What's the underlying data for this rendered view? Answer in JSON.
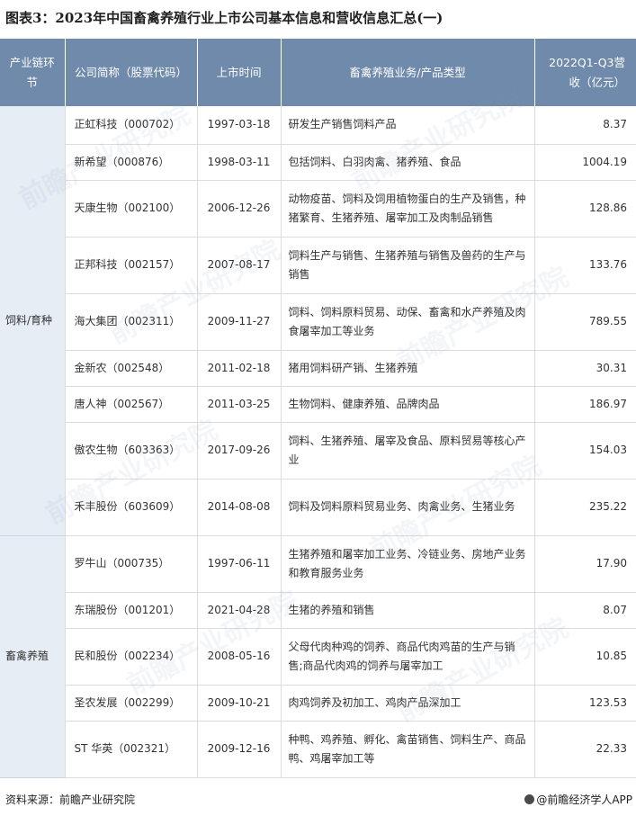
{
  "title": "图表3：2023年中国畜禽养殖行业上市公司基本信息和营收信息汇总(一)",
  "table": {
    "headers": [
      "产业链环节",
      "公司简称（股票代码）",
      "上市时间",
      "畜禽养殖业务/产品类型",
      "2022Q1-Q3营收（亿元）"
    ],
    "segments": [
      {
        "name": "饲料/育种",
        "rows": [
          {
            "company": "正虹科技（000702）",
            "date": "1997-03-18",
            "business": "研发生产销售饲料产品",
            "revenue": "8.37"
          },
          {
            "company": "新希望（000876）",
            "date": "1998-03-11",
            "business": "包括饲料、白羽肉禽、猪养殖、食品",
            "revenue": "1004.19"
          },
          {
            "company": "天康生物（002100）",
            "date": "2006-12-26",
            "business": "动物疫苗、饲料及饲用植物蛋白的生产及销售，种猪繁育、生猪养殖、屠宰加工及肉制品销售",
            "revenue": "128.86"
          },
          {
            "company": "正邦科技（002157）",
            "date": "2007-08-17",
            "business": "饲料生产与销售、生猪养殖与销售及兽药的生产与销售",
            "revenue": "133.76"
          },
          {
            "company": "海大集团（002311）",
            "date": "2009-11-27",
            "business": "饲料、饲料原料贸易、动保、畜禽和水产养殖及肉食屠宰加工等业务",
            "revenue": "789.55"
          },
          {
            "company": "金新农（002548）",
            "date": "2011-02-18",
            "business": "猪用饲料研产销、生猪养殖",
            "revenue": "30.31"
          },
          {
            "company": "唐人神（002567）",
            "date": "2011-03-25",
            "business": "生物饲料、健康养殖、品牌肉品",
            "revenue": "186.97"
          },
          {
            "company": "傲农生物（603363）",
            "date": "2017-09-26",
            "business": "饲料、生猪养殖、屠宰及食品、原料贸易等核心产业",
            "revenue": "154.03"
          },
          {
            "company": "禾丰股份（603609）",
            "date": "2014-08-08",
            "business": "饲料及饲料原料贸易业务、肉禽业务、生猪业务",
            "revenue": "235.22"
          }
        ]
      },
      {
        "name": "畜禽养殖",
        "rows": [
          {
            "company": "罗牛山（000735）",
            "date": "1997-06-11",
            "business": "生猪养殖和屠宰加工业务、冷链业务、房地产业务和教育服务业务",
            "revenue": "17.90"
          },
          {
            "company": "东瑞股份（001201）",
            "date": "2021-04-28",
            "business": "生猪的养殖和销售",
            "revenue": "8.07"
          },
          {
            "company": "民和股份（002234）",
            "date": "2008-05-16",
            "business": "父母代肉种鸡的饲养、商品代肉鸡苗的生产与销售;商品代肉鸡的饲养与屠宰加工",
            "revenue": "10.85"
          },
          {
            "company": "圣农发展（002299）",
            "date": "2009-10-21",
            "business": "肉鸡饲养及初加工、鸡肉产品深加工",
            "revenue": "123.53"
          },
          {
            "company": "ST 华英（002321）",
            "date": "2009-12-16",
            "business": "种鸭、鸡养殖、孵化、禽苗销售、饲料生产、商品鸭、鸡屠宰加工等",
            "revenue": "22.33"
          }
        ]
      }
    ]
  },
  "footer": {
    "source": "资料来源：前瞻产业研究院",
    "brand": "@前瞻经济学人APP"
  },
  "watermark": "前瞻产业研究院",
  "colors": {
    "header_bg": "#6f8aaa",
    "segment_bg": "#e6edf5",
    "grid": "#dcdcdc"
  }
}
